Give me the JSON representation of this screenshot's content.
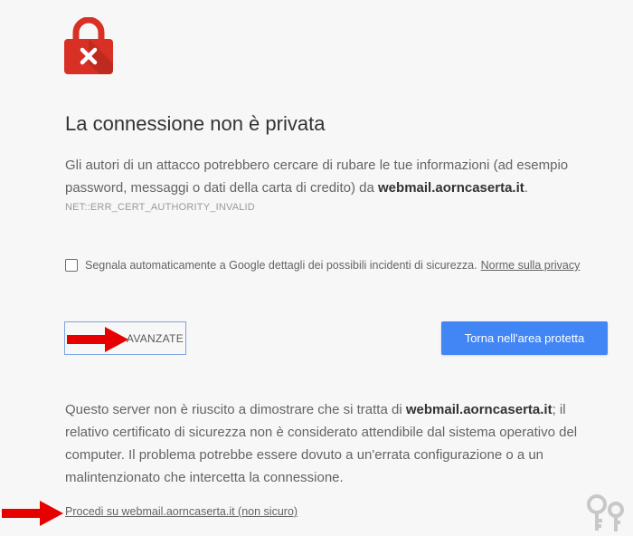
{
  "header": {
    "title": "La connessione non è privata"
  },
  "message": {
    "text_before": "Gli autori di un attacco potrebbero cercare di rubare le tue informazioni (ad esempio password, messaggi o dati della carta di credito) da ",
    "domain": "webmail.aorncaserta.it",
    "text_after": "."
  },
  "error_code": "NET::ERR_CERT_AUTHORITY_INVALID",
  "report": {
    "checked": false,
    "label": "Segnala automaticamente a Google dettagli dei possibili incidenti di sicurezza.",
    "privacy_link": "Norme sulla privacy"
  },
  "buttons": {
    "advanced_label": "AVANZATE",
    "back_label": "Torna nell'area protetta"
  },
  "details": {
    "text_before": "Questo server non è riuscito a dimostrare che si tratta di ",
    "domain": "webmail.aorncaserta.it",
    "text_after": "; il relativo certificato di sicurezza non è considerato attendibile dal sistema operativo del computer. Il problema potrebbe essere dovuto a un'errata configurazione o a un malintenzionato che intercetta la connessione."
  },
  "proceed_link": "Procedi su webmail.aorncaserta.it (non sicuro)",
  "icons": {
    "lock": "lock-error-icon",
    "arrow": "red-arrow-icon",
    "key": "key-icon"
  },
  "colors": {
    "background": "#f7f7f7",
    "lock_red": "#d93025",
    "primary_button": "#4285f4",
    "arrow_red": "#e60000"
  }
}
